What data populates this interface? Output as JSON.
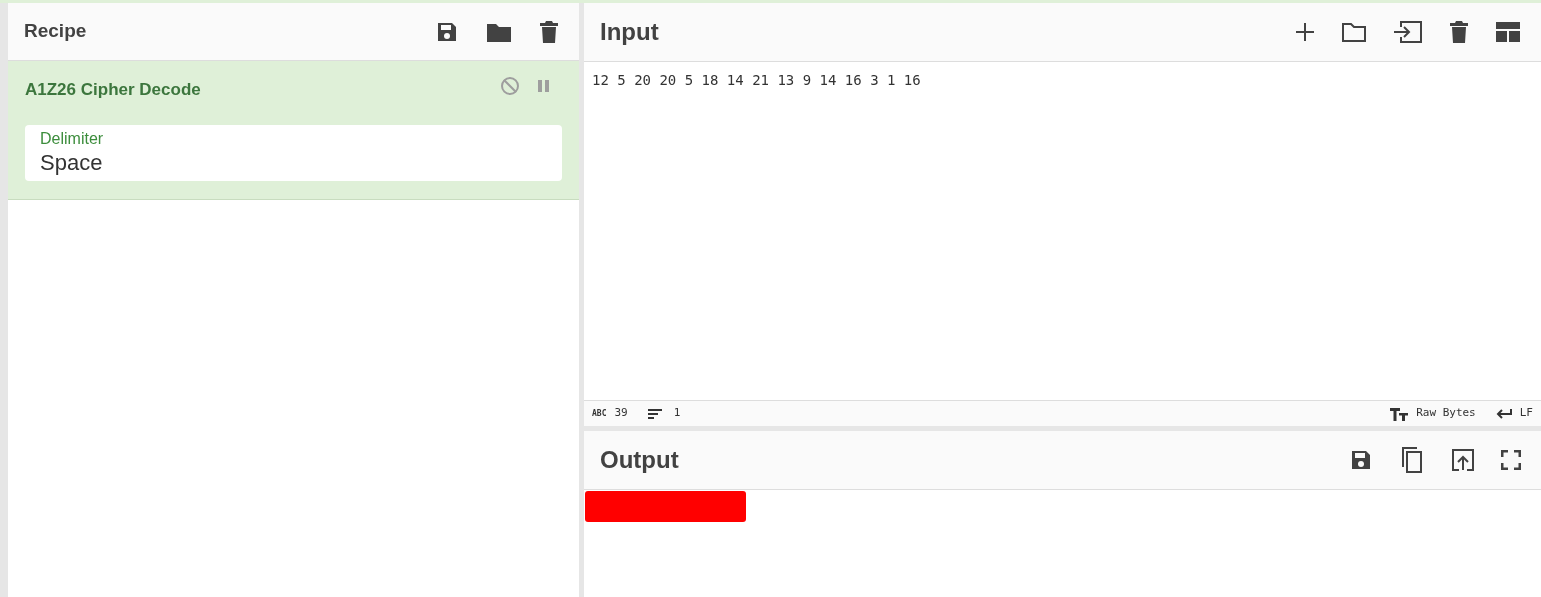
{
  "recipe": {
    "title": "Recipe",
    "operations": [
      {
        "name": "A1Z26 Cipher Decode",
        "disabled": false,
        "paused": false,
        "fields": [
          {
            "label": "Delimiter",
            "value": "Space"
          }
        ]
      }
    ]
  },
  "input": {
    "title": "Input",
    "text": "12 5 20 20 5 18 14 21 13 9 14 16 3 1 16",
    "status": {
      "length_badge": "ABC",
      "length": "39",
      "lines": "1",
      "encoding": "Raw Bytes",
      "eol": "LF"
    }
  },
  "output": {
    "title": "Output",
    "redacted": true
  }
}
